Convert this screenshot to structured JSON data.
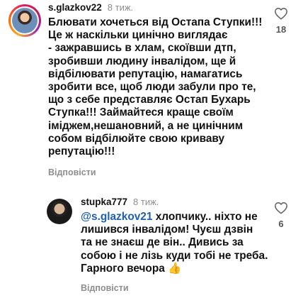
{
  "comments": [
    {
      "username": "s.glazkov22",
      "time": "8 тиж.",
      "text": "Блювати хочеться від Остапа Ступки!!!\nЦе ж наскільки цинічно виглядає\n- зажравшись в хлам, скоївши дтп,\nзробивши людину інвалідом, ще й\nвідбілювати репутацію, намагатись\nзробити все, щоб люди забули про те,\nщо з себе представляє Остап Бухарь\nСтупка!!! Займайтеся краще своїм\nіміджем,нешановний, а не цинічним\nсобом відбілюйте свою криваву\nрепутацію!!!",
      "reply_label": "Відповісти",
      "likes": "18"
    },
    {
      "username": "stupka777",
      "time": "8 тиж.",
      "mention": "@s.glazkov21",
      "text_after_mention": " хлопчику.. ніхто не\nлишився інвалідом! Чуєш дзвін\nта не знаєш де він.. Дивись за\nсобою і не лізь куди тобі не треба.\nГарного вечора ",
      "emoji": "👍",
      "reply_label": "Відповісти",
      "likes": "6"
    }
  ]
}
